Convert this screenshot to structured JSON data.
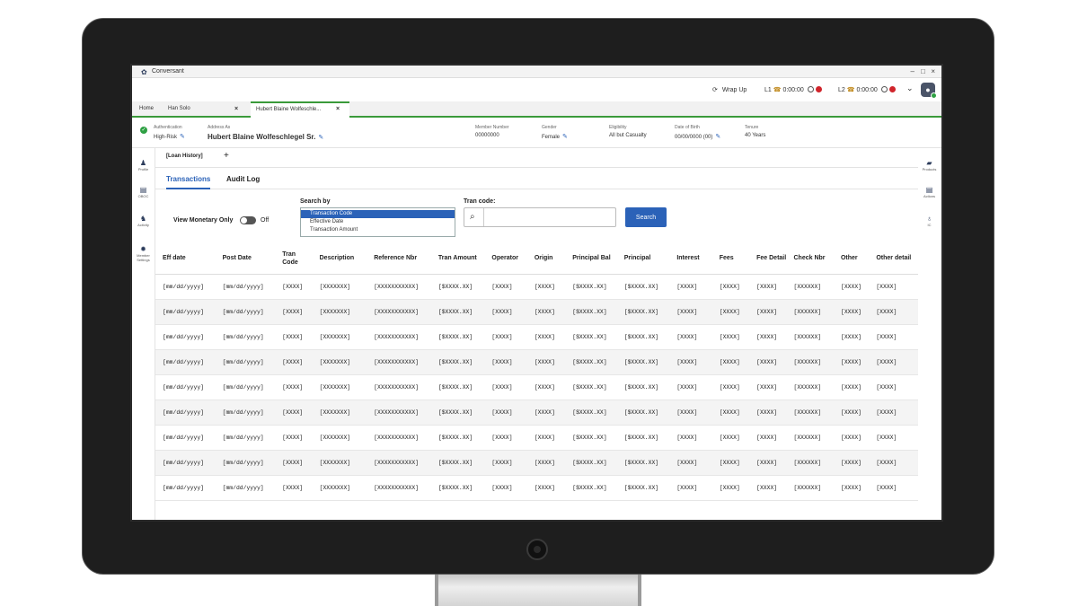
{
  "titlebar": {
    "app_title": "Conversant",
    "logo_glyph": "✿",
    "min": "–",
    "max": "□",
    "close": "×"
  },
  "topbar": {
    "wrap_up": "Wrap Up",
    "line1_label": "L1",
    "line1_time": "0:00:00",
    "line2_label": "L2",
    "line2_time": "0:00:00",
    "caret": "⌄"
  },
  "tabs": [
    {
      "label": "Home"
    },
    {
      "label": "Han Solo",
      "close": "×"
    },
    {
      "label": "Hubert Blaine Wolfeschle...",
      "close": "×"
    }
  ],
  "member": {
    "auth_label": "Authentication",
    "auth_value": "High-Risk",
    "addr_label": "Address As",
    "addr_value": "Hubert Blaine Wolfeschlegel Sr.",
    "number_label": "Member Number",
    "number_value": "00000000",
    "gender_label": "Gender",
    "gender_value": "Female",
    "elig_label": "Eligibility",
    "elig_value": "All but Casualty",
    "dob_label": "Date of Birth",
    "dob_value": "00/00/0000 (00)",
    "tenure_label": "Tenure",
    "tenure_value": "40 Years"
  },
  "left_rail": [
    {
      "icon": "person-icon",
      "label": "Profile"
    },
    {
      "icon": "id-card-icon",
      "label": "OBOC"
    },
    {
      "icon": "people-icon",
      "label": "Activity"
    },
    {
      "icon": "gear-icon",
      "label": "Member Settings"
    }
  ],
  "right_rail": [
    {
      "icon": "briefcase-icon",
      "label": "Products"
    },
    {
      "icon": "list-icon",
      "label": "Actions"
    },
    {
      "icon": "bulb-icon",
      "label": "IC"
    }
  ],
  "subtabs": {
    "loan_history": "[Loan History]",
    "add": "+"
  },
  "inner_tabs": {
    "transactions": "Transactions",
    "audit_log": "Audit Log"
  },
  "controls": {
    "view_monetary_label": "View Monetary Only",
    "toggle_state": "Off",
    "search_by_label": "Search by",
    "search_by_options": [
      "Transaction Code",
      "Effective Date",
      "Transaction Amount"
    ],
    "tran_code_label": "Tran code:",
    "tran_code_value": "",
    "search_button": "Search"
  },
  "table": {
    "headers": [
      "Eff date",
      "Post Date",
      "Tran Code",
      "Description",
      "Reference Nbr",
      "Tran Amount",
      "Operator",
      "Origin",
      "Principal Bal",
      "Principal",
      "Interest",
      "Fees",
      "Fee Detail",
      "Check Nbr",
      "Other",
      "Other detail"
    ],
    "row_template": [
      "[mm/dd/yyyy]",
      "[mm/dd/yyyy]",
      "[XXXX]",
      "[XXXXXXX]",
      "[XXXXXXXXXXX]",
      "[$XXXX.XX]",
      "[XXXX]",
      "[XXXX]",
      "[$XXXX.XX]",
      "[$XXXX.XX]",
      "[XXXX]",
      "[XXXX]",
      "[XXXX]",
      "[XXXXXX]",
      "[XXXX]",
      "[XXXX]"
    ],
    "row_count": 9
  },
  "colors": {
    "accent": "#2b62b8",
    "green": "#3a9a3a",
    "red": "#d0242b"
  }
}
